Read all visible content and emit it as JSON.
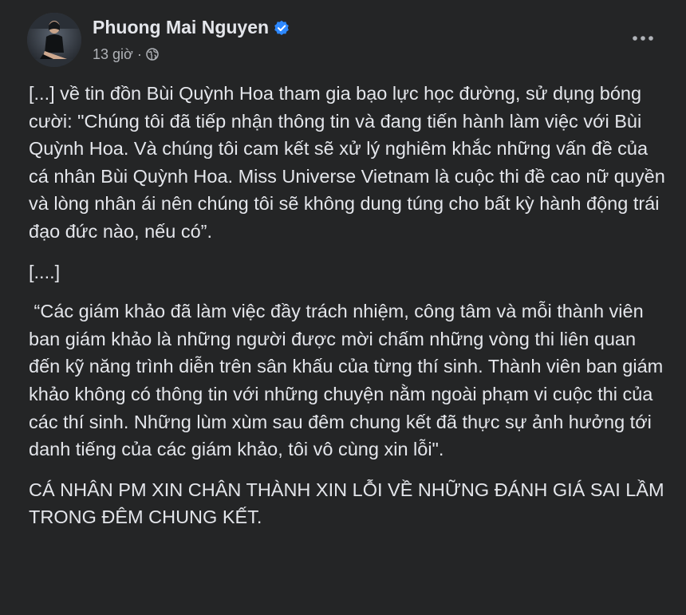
{
  "author": {
    "name": "Phuong Mai Nguyen",
    "verified_icon": "verified-badge-icon"
  },
  "meta": {
    "time": "13 giờ",
    "separator": "·",
    "privacy_icon": "globe-icon"
  },
  "actions": {
    "more_icon": "more-horizontal-icon"
  },
  "post": {
    "paragraphs": [
      "[...] về tin đồn Bùi Quỳnh Hoa tham gia bạo lực học đường, sử dụng bóng cười: \"Chúng tôi đã tiếp nhận thông tin và đang tiến hành làm việc với Bùi Quỳnh Hoa. Và chúng tôi cam kết sẽ xử lý nghiêm khắc những vấn đề của cá nhân Bùi Quỳnh Hoa. Miss Universe Vietnam là cuộc thi đề cao nữ quyền và lòng nhân ái nên chúng tôi sẽ không dung túng cho bất kỳ hành động trái đạo đức nào, nếu có”.",
      "[....]",
      " “Các giám khảo đã làm việc đầy trách nhiệm, công tâm và mỗi thành viên ban giám khảo là những người được mời chấm những vòng thi liên quan đến kỹ năng trình diễn trên sân khấu của từng thí sinh. Thành viên ban giám khảo không có thông tin với những chuyện nằm ngoài phạm vi cuộc thi của các thí sinh. Những lùm xùm sau đêm chung kết đã thực sự ảnh hưởng tới danh tiếng của các giám khảo, tôi vô cùng xin lỗi\".",
      "CÁ NHÂN PM XIN CHÂN THÀNH XIN LỖI VỀ NHỮNG ĐÁNH GIÁ SAI LẦM TRONG ĐÊM CHUNG KẾT."
    ]
  },
  "colors": {
    "background": "#242526",
    "primary_text": "#e4e6eb",
    "secondary_text": "#b0b3b8",
    "verified": "#2d88ff"
  }
}
